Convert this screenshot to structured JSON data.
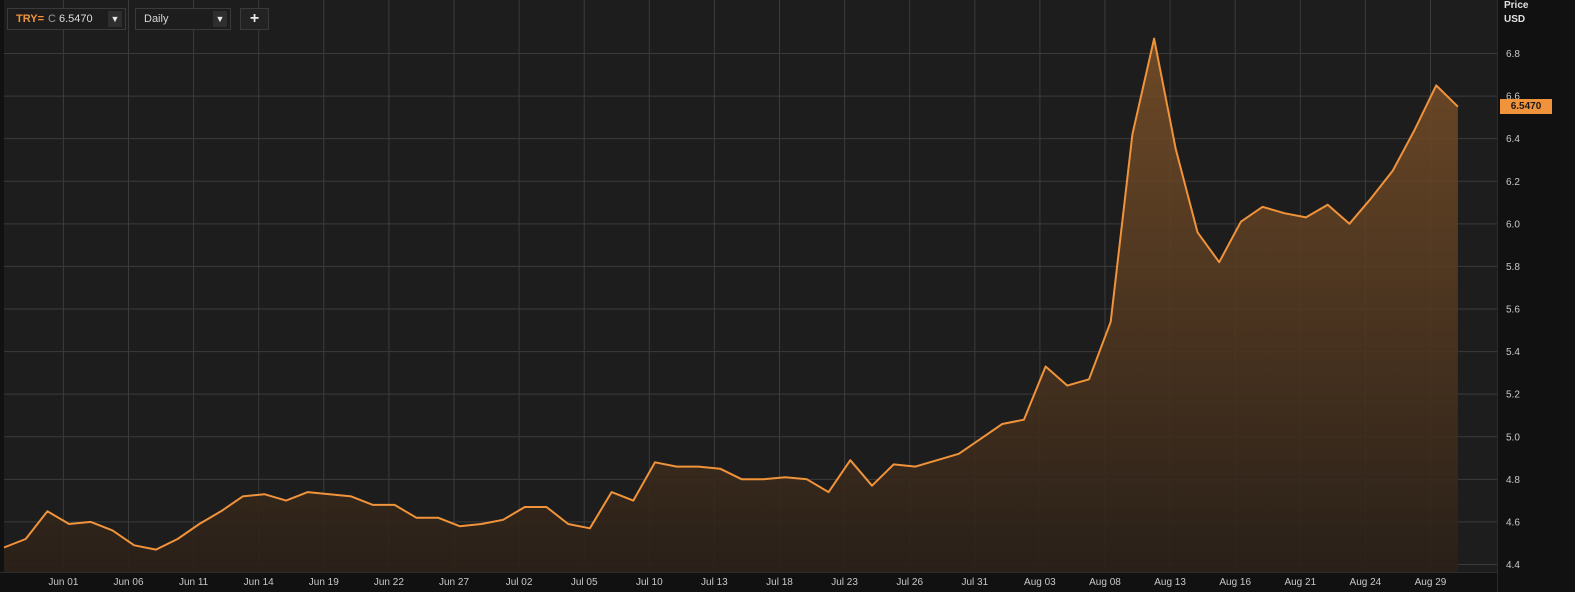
{
  "toolbar": {
    "ric_code": "TRY=",
    "ric_prefix": "C",
    "ric_value": "6.5470",
    "interval": "Daily",
    "add_label": "+"
  },
  "colors": {
    "background": "#111111",
    "plot_background": "#1d1d1d",
    "grid": "#3b3b3b",
    "line": "#f0933a",
    "axis_text": "#c8c8c8"
  },
  "chart_data": {
    "type": "area",
    "title": "",
    "ylabel": "Price",
    "yunit": "USD",
    "ylim": [
      4.4,
      7.0
    ],
    "yticks": [
      "4.4",
      "4.6",
      "4.8",
      "5.0",
      "5.2",
      "5.4",
      "5.6",
      "5.8",
      "6.0",
      "6.2",
      "6.4",
      "6.6",
      "6.8"
    ],
    "xtick_labels": [
      "Jun 01",
      "Jun 06",
      "Jun 11",
      "Jun 14",
      "Jun 19",
      "Jun 22",
      "Jun 27",
      "Jul 02",
      "Jul 05",
      "Jul 10",
      "Jul 13",
      "Jul 18",
      "Jul 23",
      "Jul 26",
      "Jul 31",
      "Aug 03",
      "Aug 08",
      "Aug 13",
      "Aug 16",
      "Aug 21",
      "Aug 24",
      "Aug 29"
    ],
    "grid": true,
    "last_value": "6.5470",
    "series": [
      {
        "x": [
          "May 30",
          "May 31",
          "Jun 01",
          "Jun 04",
          "Jun 05",
          "Jun 06",
          "Jun 07",
          "Jun 08",
          "Jun 11",
          "Jun 12",
          "Jun 13",
          "Jun 14",
          "Jun 15",
          "Jun 18",
          "Jun 19",
          "Jun 20",
          "Jun 21",
          "Jun 22",
          "Jun 25",
          "Jun 26",
          "Jun 27",
          "Jun 28",
          "Jun 29",
          "Jul 02",
          "Jul 03",
          "Jul 04",
          "Jul 05",
          "Jul 06",
          "Jul 09",
          "Jul 10",
          "Jul 11",
          "Jul 12",
          "Jul 13",
          "Jul 16",
          "Jul 17",
          "Jul 18",
          "Jul 19",
          "Jul 20",
          "Jul 23",
          "Jul 24",
          "Jul 25",
          "Jul 26",
          "Jul 27",
          "Jul 30",
          "Jul 31",
          "Aug 01",
          "Aug 02",
          "Aug 03",
          "Aug 06",
          "Aug 07",
          "Aug 08",
          "Aug 09",
          "Aug 10",
          "Aug 13",
          "Aug 14",
          "Aug 15",
          "Aug 16",
          "Aug 17",
          "Aug 20",
          "Aug 21",
          "Aug 22",
          "Aug 23",
          "Aug 24",
          "Aug 27",
          "Aug 28",
          "Aug 29",
          "Aug 30",
          "Aug 31"
        ],
        "values": [
          4.48,
          4.52,
          4.65,
          4.59,
          4.6,
          4.56,
          4.49,
          4.47,
          4.52,
          4.59,
          4.65,
          4.72,
          4.73,
          4.7,
          4.74,
          4.73,
          4.72,
          4.68,
          4.68,
          4.62,
          4.62,
          4.58,
          4.59,
          4.61,
          4.67,
          4.67,
          4.59,
          4.57,
          4.74,
          4.7,
          4.88,
          4.86,
          4.86,
          4.85,
          4.8,
          4.8,
          4.81,
          4.8,
          4.74,
          4.89,
          4.77,
          4.87,
          4.86,
          4.89,
          4.92,
          4.99,
          5.06,
          5.08,
          5.33,
          5.24,
          5.27,
          5.54,
          6.42,
          6.87,
          6.35,
          5.96,
          5.82,
          6.01,
          6.08,
          6.05,
          6.03,
          6.09,
          6.0,
          6.12,
          6.25,
          6.44,
          6.65,
          6.55
        ]
      }
    ]
  }
}
